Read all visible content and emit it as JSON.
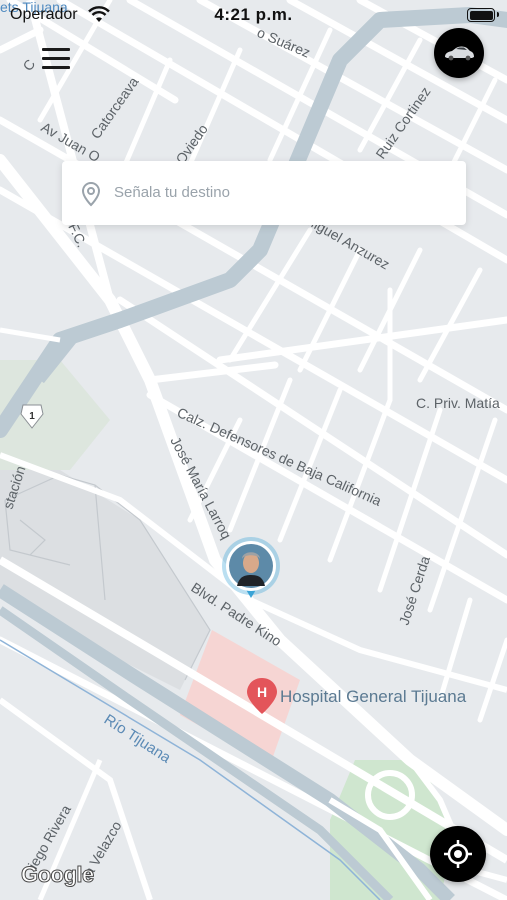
{
  "status_bar": {
    "carrier": "Operador",
    "time": "4:21 p.m."
  },
  "search": {
    "placeholder": "Señala tu destino"
  },
  "map": {
    "attribution": "Google",
    "labels": {
      "tijuana_top": "ets Tijuana",
      "suarez": "o Suárez",
      "c_left": "C",
      "catorceava": "Catorceava",
      "av_juan": "Av Juan O",
      "oviedo": "Oviedo",
      "ruiz_cortinez": "Ruiz Cortinez",
      "miguel_anzurez": "Miguel Anzurez",
      "fc": "F.C.",
      "priv_matia": "C. Priv. Matía",
      "defensores": "Calz. Defensores de Baja California",
      "jose_maria": "José María Larroq",
      "padre_kino": "Blvd. Padre Kino",
      "hospital": "Hospital General Tijuana",
      "jose_cerda": "José Cerda",
      "rio_tijuana": "Río Tijuana",
      "estacion": "stación",
      "diego_rivera": "iego Rivera",
      "velazco": "ia Velazco",
      "route_1": "1",
      "hospital_marker": "H"
    }
  },
  "colors": {
    "map_bg": "#e7eaed",
    "road": "#ffffff",
    "highway": "#b9c7d0",
    "park": "#cfe6cf",
    "hospital_area": "#f6d5d3",
    "hospital_text": "#5b7a92",
    "hospital_pin": "#e3555a",
    "river_line": "#8fb4d8",
    "button_bg": "#000000"
  },
  "icons": {
    "menu": "hamburger-menu-icon",
    "car": "car-icon",
    "search_pin": "location-pin-icon",
    "my_location": "crosshair-location-icon",
    "wifi": "wifi-icon",
    "battery": "battery-icon"
  }
}
